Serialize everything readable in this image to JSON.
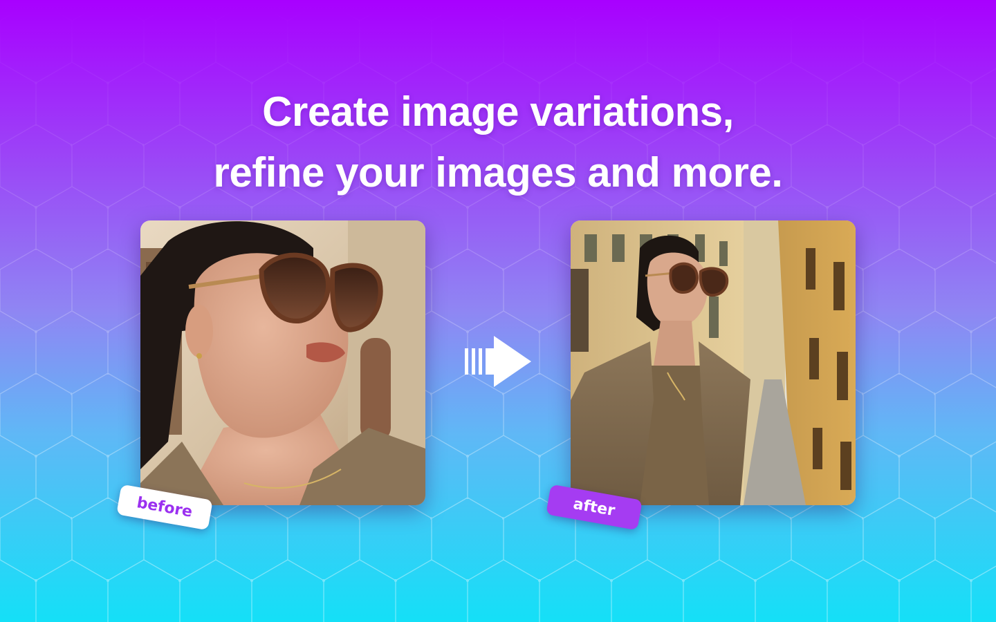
{
  "headline": {
    "line1": "Create image variations,",
    "line2": "refine your images and more."
  },
  "comparison": {
    "before_label": "before",
    "after_label": "after",
    "before_image": "close-up portrait of woman in brown sunglasses and beige blazer",
    "after_image": "woman in sunglasses and brown blazer standing in narrow old town street",
    "arrow_icon": "fast-forward-arrow-icon"
  },
  "colors": {
    "gradient_top": "#a800ff",
    "gradient_bottom": "#14e0f7",
    "headline_text": "#ffffff",
    "before_tag_bg": "#ffffff",
    "before_tag_text": "#9b30f0",
    "after_tag_bg": "#a53cf2",
    "after_tag_text": "#ffffff"
  }
}
